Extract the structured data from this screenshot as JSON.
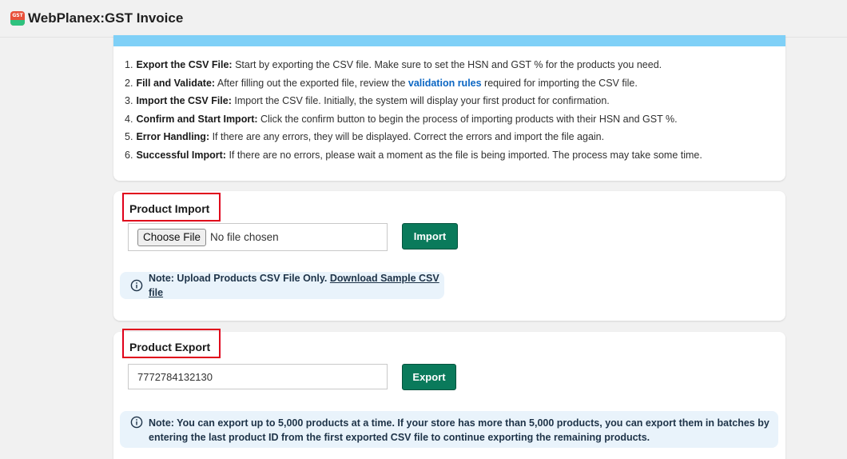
{
  "app": {
    "logo_text": "GST",
    "title": "WebPlanex:GST Invoice"
  },
  "steps": [
    {
      "num": "1.",
      "title": "Export the CSV File:",
      "text": " Start by exporting the CSV file. Make sure to set the HSN and GST % for the products you need."
    },
    {
      "num": "2.",
      "title": "Fill and Validate:",
      "text": " After filling out the exported file, review the ",
      "link": "validation rules",
      "text_after": " required for importing the CSV file."
    },
    {
      "num": "3.",
      "title": "Import the CSV File:",
      "text": " Import the CSV file. Initially, the system will display your first product for confirmation."
    },
    {
      "num": "4.",
      "title": "Confirm and Start Import:",
      "text": " Click the confirm button to begin the process of importing products with their HSN and GST %."
    },
    {
      "num": "5.",
      "title": "Error Handling:",
      "text": " If there are any errors, they will be displayed. Correct the errors and import the file again."
    },
    {
      "num": "6.",
      "title": "Successful Import:",
      "text": " If there are no errors, please wait a moment as the file is being imported. The process may take some time."
    }
  ],
  "import_section": {
    "title": "Product Import",
    "choose_file_label": "Choose File",
    "file_status": "No file chosen",
    "button_label": "Import",
    "note_text": "Note: Upload Products CSV File Only. ",
    "note_link": "Download Sample CSV file"
  },
  "export_section": {
    "title": "Product Export",
    "input_value": "7772784132130",
    "button_label": "Export",
    "note_text": "Note: You can export up to 5,000 products at a time. If your store has more than 5,000 products, you can export them in batches by entering the last product ID from the first exported CSV file to continue exporting the remaining products."
  },
  "colors": {
    "accent_bar": "#7fd0f7",
    "primary_button": "#0a7a5b",
    "highlight_border": "#e0001b",
    "note_background": "#e9f3fb",
    "link": "#0b66c3"
  },
  "icons": {
    "info": "info-circle-icon",
    "logo": "gst-app-logo-icon"
  }
}
